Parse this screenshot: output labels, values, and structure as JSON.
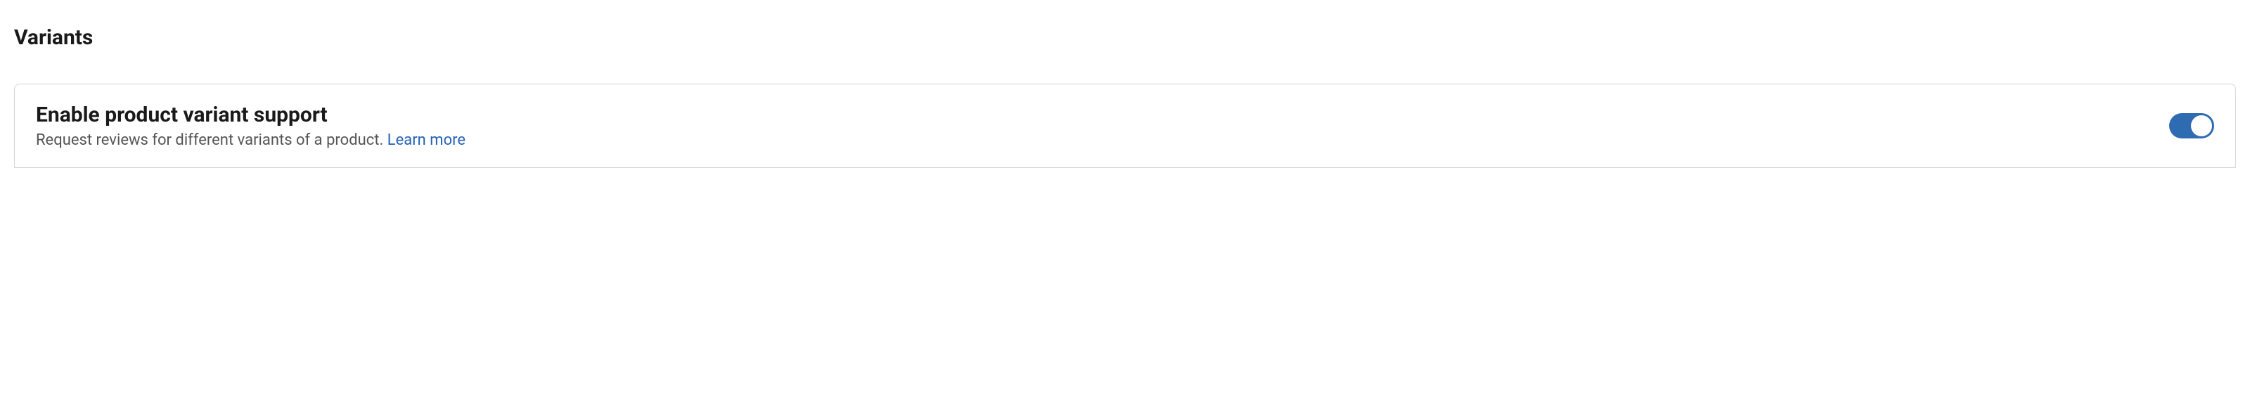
{
  "section": {
    "title": "Variants"
  },
  "card": {
    "title": "Enable product variant support",
    "description_prefix": "Request reviews for different variants of a product. ",
    "learn_more": "Learn more",
    "toggle_enabled": true
  }
}
